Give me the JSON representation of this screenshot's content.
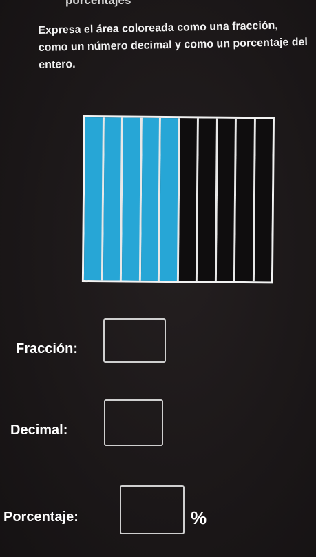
{
  "page": {
    "top_title": "porcentajes",
    "instructions": "Expresa el área coloreada como una fracción, como un número decimal y como un porcentaje del entero."
  },
  "figure": {
    "total_parts": 10,
    "shaded_parts": 5,
    "shaded_color": "#27a6d6",
    "unshaded_color": "#0f0d0e"
  },
  "answers": {
    "fraction_label": "Fracción:",
    "fraction_value": "",
    "decimal_label": "Decimal:",
    "decimal_value": "",
    "percent_label": "Porcentaje:",
    "percent_value": "",
    "percent_sign": "%"
  }
}
